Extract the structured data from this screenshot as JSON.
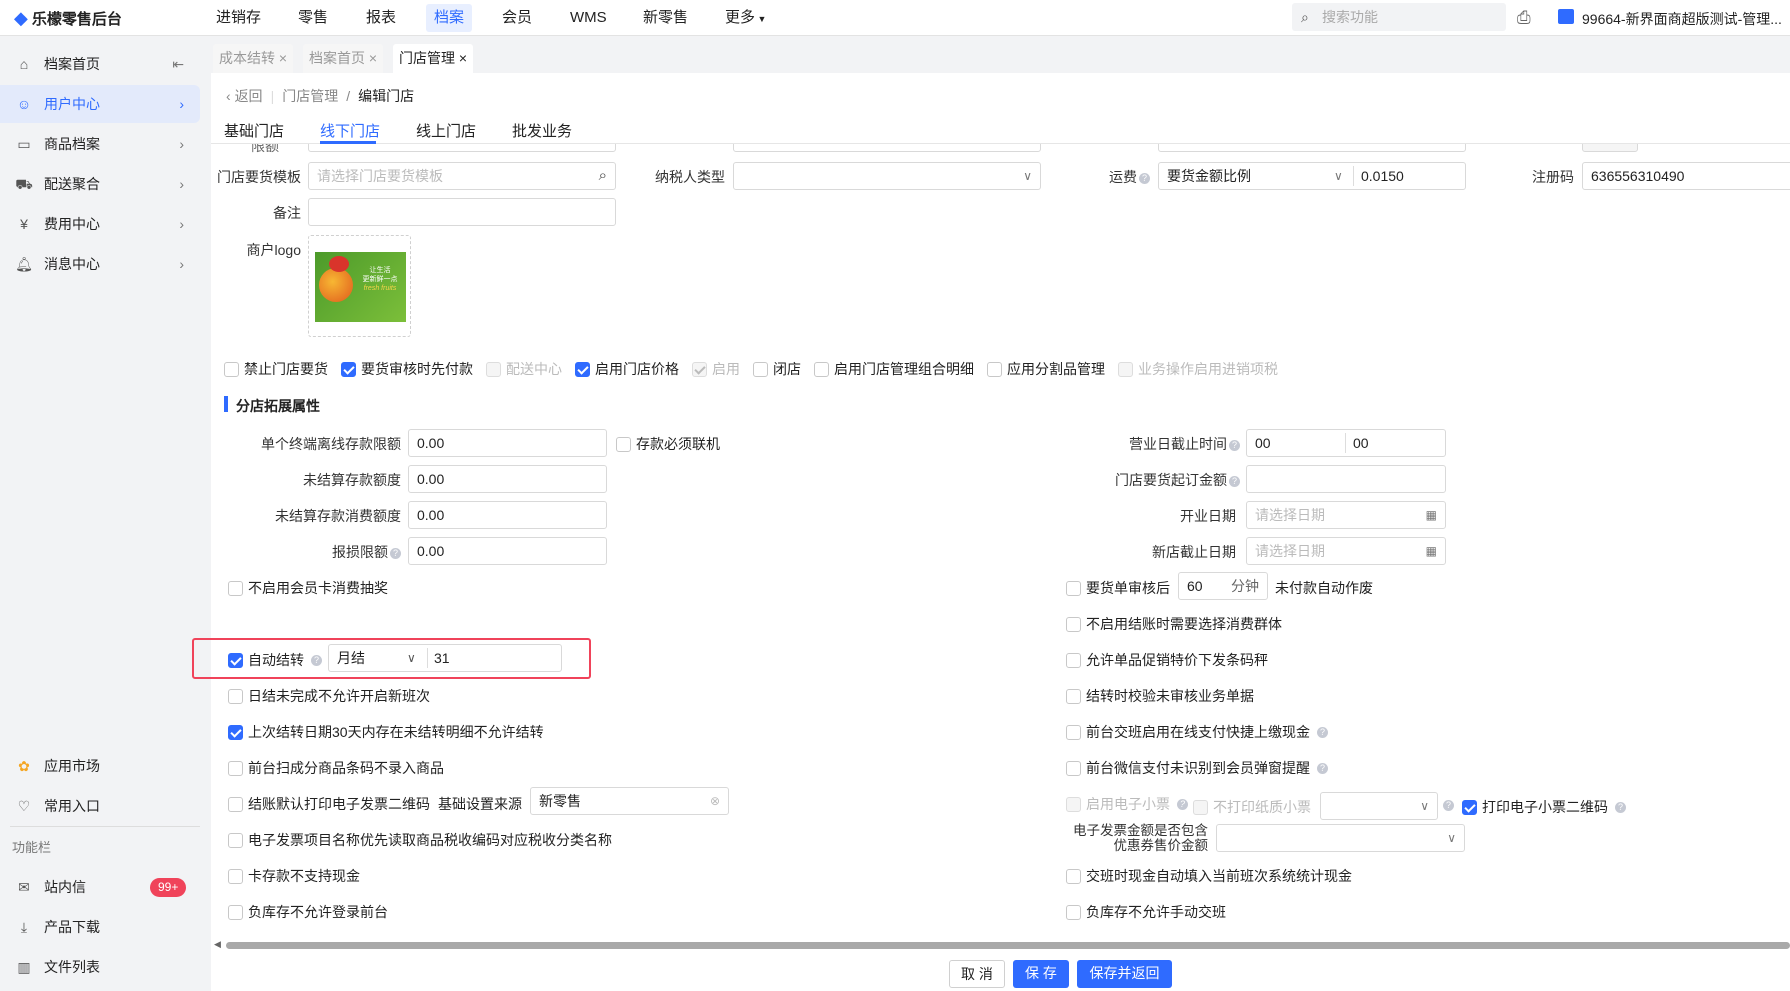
{
  "app": {
    "title": "乐檬零售后台"
  },
  "topnav": [
    {
      "label": "进销存"
    },
    {
      "label": "零售"
    },
    {
      "label": "报表"
    },
    {
      "label": "档案",
      "active": true
    },
    {
      "label": "会员"
    },
    {
      "label": "WMS"
    },
    {
      "label": "新零售"
    },
    {
      "label": "更多"
    }
  ],
  "search": {
    "placeholder": "搜索功能"
  },
  "account": {
    "name": "99664-新界面商超版测试-管理..."
  },
  "sidebar": {
    "items": [
      {
        "label": "档案首页",
        "icon": "home-icon"
      },
      {
        "label": "用户中心",
        "icon": "user-icon",
        "active": true
      },
      {
        "label": "商品档案",
        "icon": "box-icon"
      },
      {
        "label": "配送聚合",
        "icon": "delivery-icon"
      },
      {
        "label": "费用中心",
        "icon": "yen-icon"
      },
      {
        "label": "消息中心",
        "icon": "bell-icon"
      }
    ],
    "bottom": [
      {
        "label": "应用市场",
        "icon": "app-market-icon"
      },
      {
        "label": "常用入口",
        "icon": "heart-icon"
      }
    ],
    "section": "功能栏",
    "func": [
      {
        "label": "站内信",
        "icon": "mail-icon",
        "badge": "99+"
      },
      {
        "label": "产品下载",
        "icon": "download-icon"
      },
      {
        "label": "文件列表",
        "icon": "chart-icon"
      }
    ]
  },
  "tabs": [
    {
      "label": "成本结转"
    },
    {
      "label": "档案首页"
    },
    {
      "label": "门店管理",
      "active": true
    }
  ],
  "breadcrumb": {
    "back": "返回",
    "parent": "门店管理",
    "current": "编辑门店"
  },
  "subtabs": [
    {
      "label": "基础门店"
    },
    {
      "label": "线下门店",
      "active": true
    },
    {
      "label": "线上门店"
    },
    {
      "label": "批发业务"
    }
  ],
  "form": {
    "partial_label": "限额",
    "template": {
      "label": "门店要货模板",
      "placeholder": "请选择门店要货模板"
    },
    "taxpayer": {
      "label": "纳税人类型",
      "value": ""
    },
    "freight": {
      "label": "运费",
      "mode": "要货金额比例",
      "value": "0.0150"
    },
    "regcode": {
      "label": "注册码",
      "value": "636556310490"
    },
    "remark": {
      "label": "备注",
      "value": ""
    },
    "logo": {
      "label": "商户logo",
      "image_text": "让生活 更新鲜一点 fresh fruits"
    },
    "checks": [
      {
        "label": "禁止门店要货",
        "checked": false
      },
      {
        "label": "要货审核时先付款",
        "checked": true
      },
      {
        "label": "配送中心",
        "checked": false,
        "disabled": true
      },
      {
        "label": "启用门店价格",
        "checked": true
      },
      {
        "label": "启用",
        "checked": true,
        "disabled": true
      },
      {
        "label": "闭店",
        "checked": false
      },
      {
        "label": "启用门店管理组合明细",
        "checked": false
      },
      {
        "label": "应用分割品管理",
        "checked": false
      },
      {
        "label": "业务操作启用进销项税",
        "checked": false,
        "disabled": true
      }
    ]
  },
  "ext": {
    "title": "分店拓展属性",
    "left_fields": [
      {
        "label": "单个终端离线存款限额",
        "value": "0.00"
      },
      {
        "label": "未结算存款额度",
        "value": "0.00"
      },
      {
        "label": "未结算存款消费额度",
        "value": "0.00"
      },
      {
        "label": "报损限额",
        "value": "0.00",
        "help": true
      }
    ],
    "must_online": "存款必须联机",
    "right_fields": {
      "cutoff": {
        "label": "营业日截止时间",
        "h": "00",
        "m": "00"
      },
      "min_order": {
        "label": "门店要货起订金额",
        "value": ""
      },
      "open_date": {
        "label": "开业日期",
        "placeholder": "请选择日期"
      },
      "new_end": {
        "label": "新店截止日期",
        "placeholder": "请选择日期"
      }
    },
    "left_checks": [
      {
        "label": "不启用会员卡消费抽奖",
        "checked": false
      },
      {
        "label": "日结未完成不允许开启新班次",
        "checked": false
      },
      {
        "label": "上次结转日期30天内存在未结转明细不允许结转",
        "checked": true
      },
      {
        "label": "前台扫成分商品条码不录入商品",
        "checked": false
      },
      {
        "label": "结账默认打印电子发票二维码",
        "checked": false
      },
      {
        "label": "电子发票项目名称优先读取商品税收编码对应税收分类名称",
        "checked": false
      },
      {
        "label": "卡存款不支持现金",
        "checked": false
      },
      {
        "label": "负库存不允许登录前台",
        "checked": false
      }
    ],
    "auto_carry": {
      "label": "自动结转",
      "checked": true,
      "period": "月结",
      "day": "31"
    },
    "base_source": {
      "label": "基础设置来源",
      "value": "新零售"
    },
    "order_review": {
      "label": "要货单审核后",
      "minutes": "60",
      "unit": "分钟",
      "suffix": "未付款自动作废"
    },
    "right_checks": [
      {
        "label": "不启用结账时需要选择消费群体",
        "checked": false
      },
      {
        "label": "允许单品促销特价下发条码秤",
        "checked": false
      },
      {
        "label": "结转时校验未审核业务单据",
        "checked": false
      },
      {
        "label": "前台交班启用在线支付快捷上缴现金",
        "checked": false,
        "help": true
      },
      {
        "label": "前台微信支付未识别到会员弹窗提醒",
        "checked": false,
        "help": true
      }
    ],
    "e_receipt": {
      "label": "启用电子小票",
      "checked": false
    },
    "no_paper": {
      "label": "不打印纸质小票",
      "checked": false
    },
    "print_qr": {
      "label": "打印电子小票二维码",
      "checked": true
    },
    "invoice_coupon": {
      "label1": "电子发票金额是否包含",
      "label2": "优惠券售价金额",
      "value": ""
    },
    "right_checks2": [
      {
        "label": "交班时现金自动填入当前班次系统统计现金",
        "checked": false
      },
      {
        "label": "负库存不允许手动交班",
        "checked": false
      }
    ]
  },
  "footer": {
    "cancel": "取 消",
    "save": "保 存",
    "save_back": "保存并返回"
  },
  "colors": {
    "accent": "#2f6bff",
    "highlight": "#f0435a"
  }
}
